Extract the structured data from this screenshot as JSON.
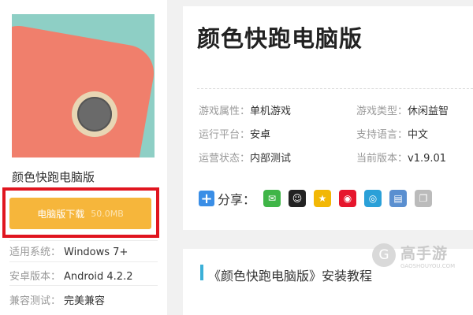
{
  "game": {
    "name": "颜色快跑电脑版",
    "download_label": "电脑版下载",
    "download_size": "50.0MB",
    "system_label": "适用系统：",
    "system_value": "Windows 7+",
    "android_label": "安卓版本：",
    "android_value": "Android 4.2.2",
    "compat_label": "兼容测试：",
    "compat_value": "完美兼容"
  },
  "details": {
    "title": "颜色快跑电脑版",
    "attributes": [
      {
        "label": "游戏属性：",
        "value": "单机游戏"
      },
      {
        "label": "游戏类型：",
        "value": "休闲益智"
      },
      {
        "label": "运行平台：",
        "value": "安卓"
      },
      {
        "label": "支持语言：",
        "value": "中文"
      },
      {
        "label": "运营状态：",
        "value": "内部测试"
      },
      {
        "label": "当前版本：",
        "value": "v1.9.01"
      }
    ],
    "share_label": "分享："
  },
  "share_icons": [
    {
      "name": "wechat-icon",
      "color": "#3fb547",
      "glyph": "✉"
    },
    {
      "name": "qq-icon",
      "color": "#222222",
      "glyph": "☺"
    },
    {
      "name": "qzone-icon",
      "color": "#f2b705",
      "glyph": "★"
    },
    {
      "name": "weibo-icon",
      "color": "#e6162d",
      "glyph": "◉"
    },
    {
      "name": "tencent-weibo-icon",
      "color": "#2aa0d8",
      "glyph": "◎"
    },
    {
      "name": "print-icon",
      "color": "#5a8fd0",
      "glyph": "▤"
    },
    {
      "name": "copy-icon",
      "color": "#bbbbbb",
      "glyph": "❐"
    }
  ],
  "section": {
    "title": "《颜色快跑电脑版》安装教程"
  },
  "watermark": {
    "brand": "高手游",
    "url": "GAOSHOUYOU.COM"
  },
  "colors": {
    "download_button": "#f6b63b",
    "highlight_border": "#e0151f",
    "accent": "#3bb0d8"
  }
}
